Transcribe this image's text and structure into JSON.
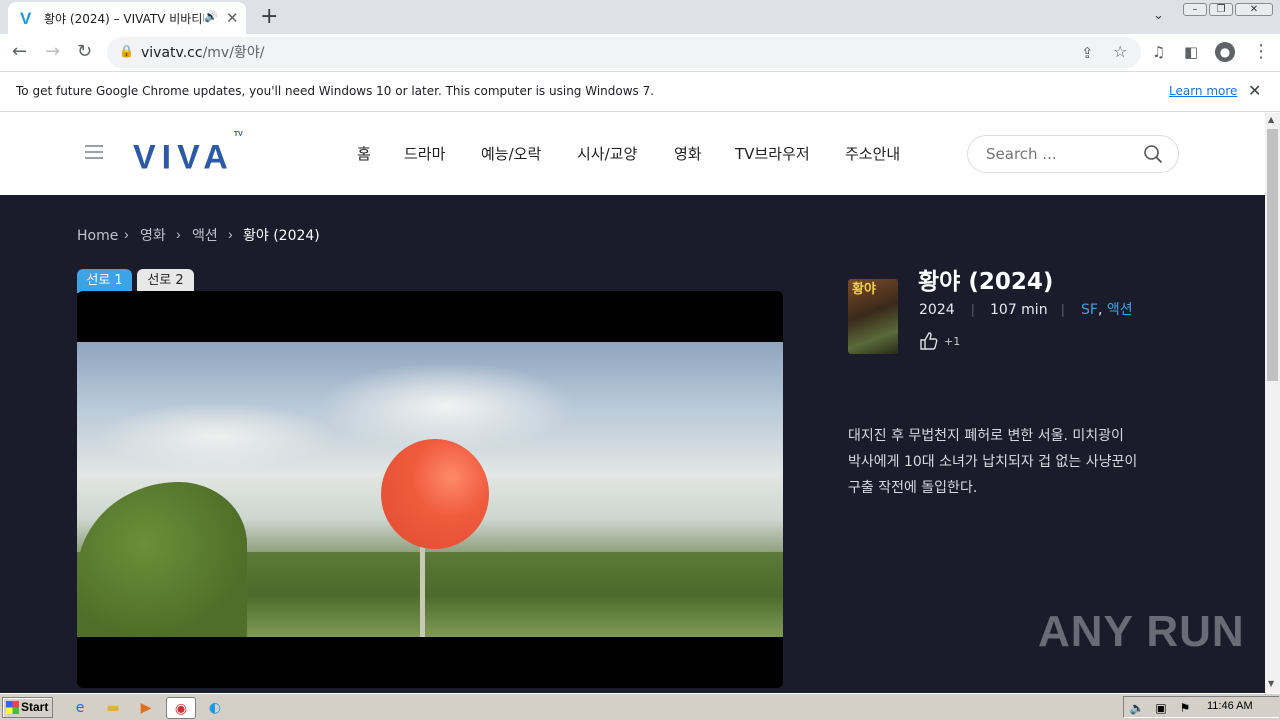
{
  "browser": {
    "tab": {
      "title": "황야 (2024) – VIVATV 비바티비",
      "favicon": "V"
    },
    "url": {
      "host": "vivatv.cc",
      "path": "/mv/황야/"
    },
    "infobar": {
      "message": "To get future Google Chrome updates, you'll need Windows 10 or later. This computer is using Windows 7.",
      "learn_more": "Learn more"
    }
  },
  "site": {
    "logo": "VIVA",
    "logo_tm": "TV",
    "nav": [
      "홈",
      "드라마",
      "예능/오락",
      "시사/교양",
      "영화",
      "TV브라우저",
      "주소안내"
    ],
    "search_placeholder": "Search ..."
  },
  "breadcrumb": [
    "Home",
    "영화",
    "액션",
    "황야 (2024)"
  ],
  "servers": [
    "선로 1",
    "선로 2"
  ],
  "movie": {
    "title": "황야 (2024)",
    "poster_text": "황야",
    "year": "2024",
    "runtime": "107 min",
    "genres": [
      "SF",
      "액션"
    ],
    "genre_sep": ",",
    "likes": "+1",
    "synopsis": "대지진 후 무법천지 폐허로 변한 서울. 미치광이 박사에게 10대 소녀가 납치되자 겁 없는 사냥꾼이 구출 작전에 돌입한다."
  },
  "watermark": "ANY RUN",
  "taskbar": {
    "start": "Start",
    "clock": "11:46 AM"
  },
  "colors": {
    "accent": "#3aa4e6",
    "logo": "#2b5ba8",
    "page_bg": "#1b1c2b"
  }
}
